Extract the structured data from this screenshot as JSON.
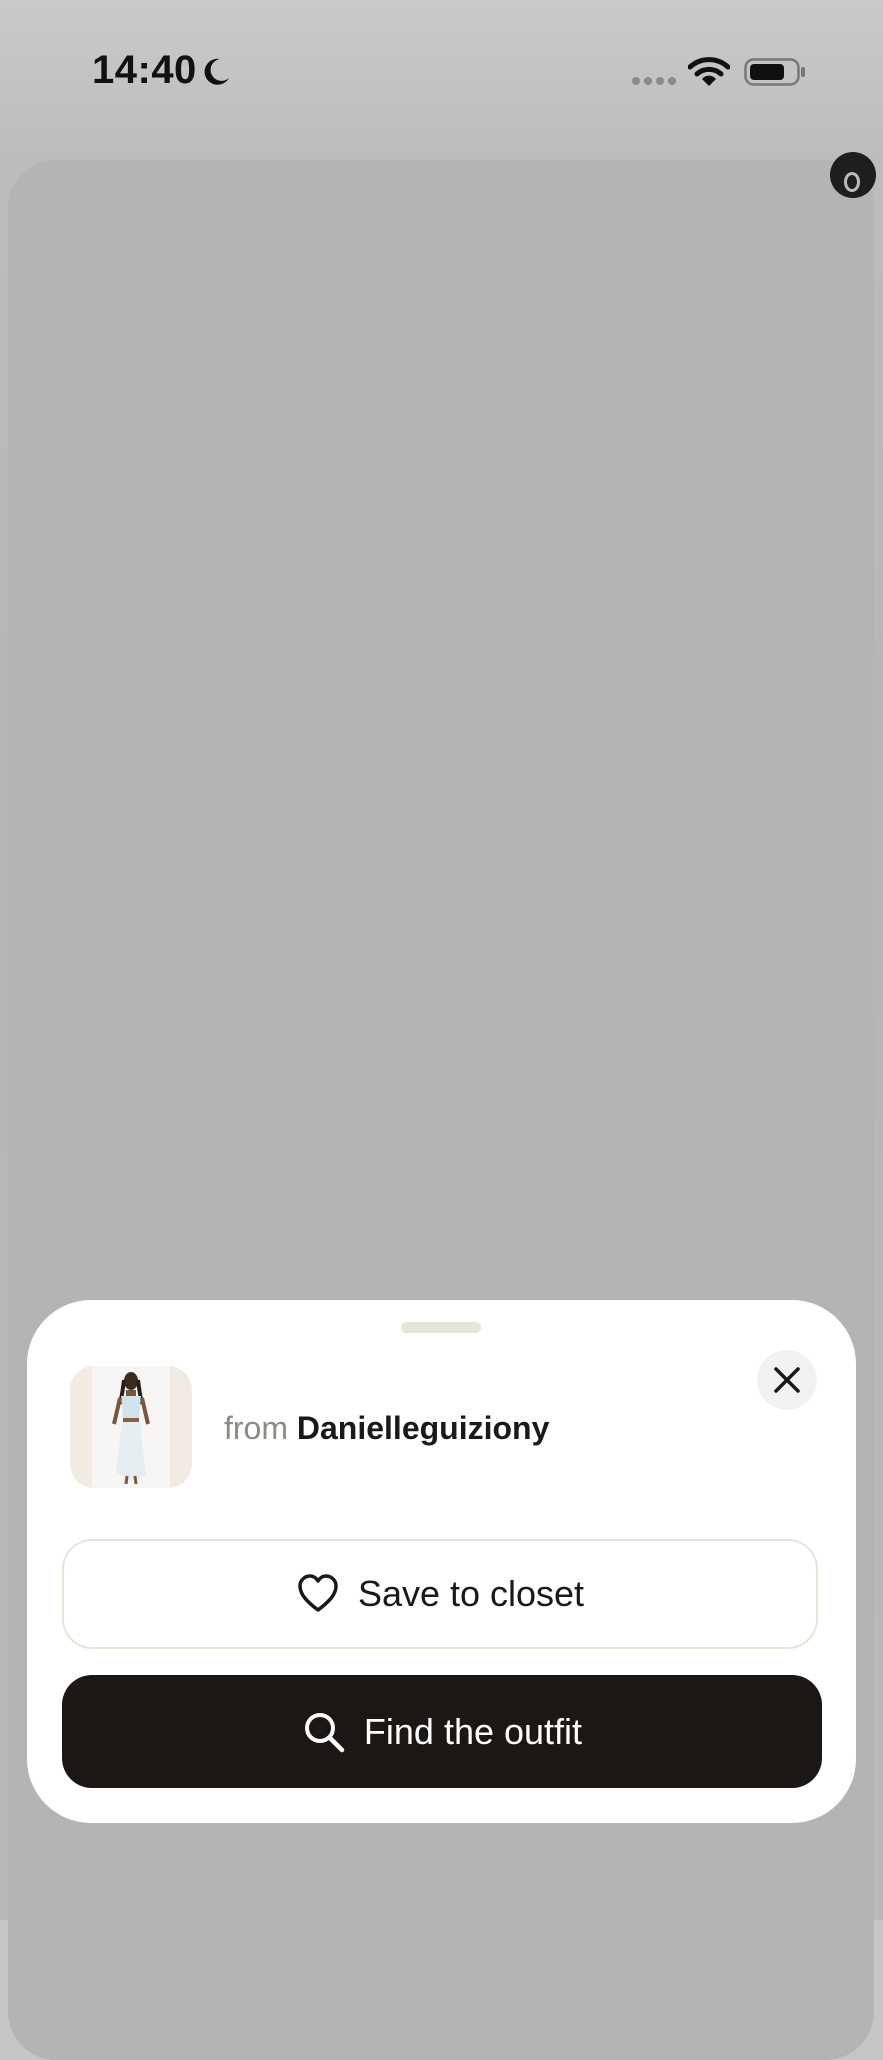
{
  "status_bar": {
    "time": "14:40",
    "icons": [
      "moon-icon",
      "cellular-signal-icon",
      "wifi-icon",
      "battery-icon"
    ]
  },
  "sheet": {
    "source_prefix": "from",
    "source_name": "Danielleguiziony",
    "save_label": "Save to closet",
    "find_label": "Find the outfit",
    "close_icon": "close-icon",
    "save_icon": "heart-icon",
    "find_icon": "search-icon"
  },
  "colors": {
    "primary_button": "#1a1715",
    "secondary_border": "#ece2d6",
    "muted_text": "#8e8983",
    "overlay": "#b6b6b5"
  }
}
